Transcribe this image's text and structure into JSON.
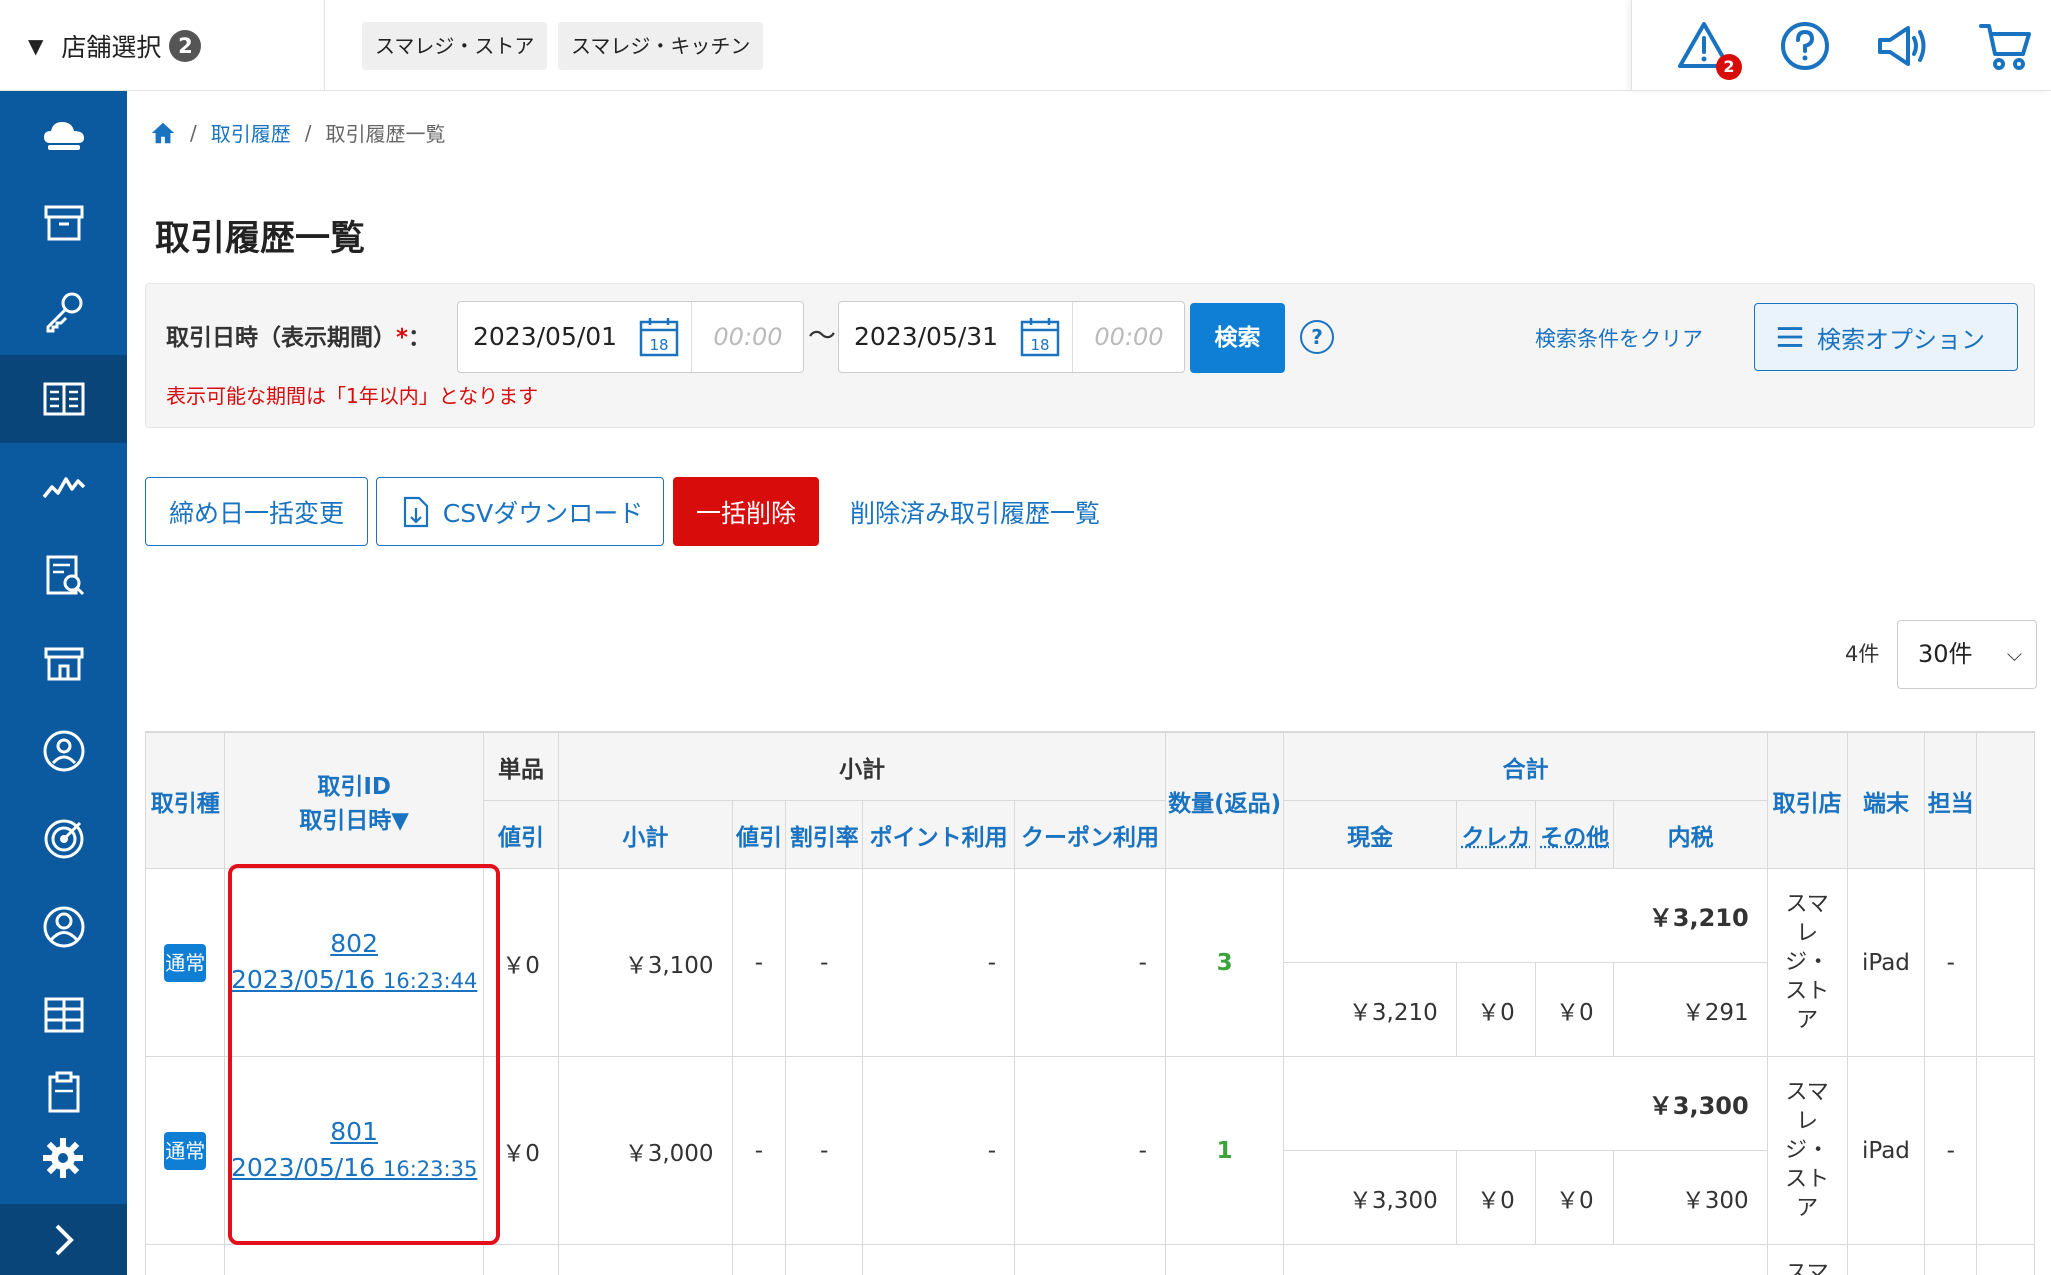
{
  "topbar": {
    "store_select_label": "店舗選択",
    "store_select_count": "2",
    "store_tags": [
      "スマレジ・ストア",
      "スマレジ・キッチン"
    ],
    "alert_count": "2",
    "icons": [
      "alert-icon",
      "help-icon",
      "announcement-icon",
      "cart-icon"
    ]
  },
  "sidebar": {
    "icons": [
      "cloud-icon",
      "archive-icon",
      "key-icon",
      "book-icon",
      "chart-icon",
      "report-icon",
      "store-icon",
      "customer-icon",
      "target-icon",
      "user-icon",
      "grid-icon",
      "clipboard-icon"
    ],
    "settings_icon": "gear-icon",
    "expand_icon": "chevron-right-icon"
  },
  "breadcrumb": {
    "home_icon": "home-icon",
    "level1": "取引履歴",
    "level2": "取引履歴一覧"
  },
  "page": {
    "title": "取引履歴一覧"
  },
  "search": {
    "label": "取引日時（表示期間）",
    "required_mark": "*",
    "colon": "：",
    "from_date": "2023/05/01",
    "from_time": "00:00",
    "to_date": "2023/05/31",
    "to_time": "00:00",
    "tilde": "〜",
    "calendar_day": "18",
    "search_button": "検索",
    "help": "?",
    "clear_link": "検索条件をクリア",
    "options_button": "検索オプション",
    "note": "表示可能な期間は「1年以内」となります"
  },
  "actions": {
    "bulk_close_date": "締め日一括変更",
    "csv_download": "CSVダウンロード",
    "bulk_delete": "一括削除",
    "deleted_history": "削除済み取引履歴一覧"
  },
  "pagination": {
    "count": "4件",
    "per_page": "30件"
  },
  "table": {
    "headers": {
      "kind": "取引種",
      "id": "取引ID",
      "datetime": "取引日時▼",
      "item": "単品",
      "item_discount": "値引",
      "subtotal_group": "小計",
      "subtotal": "小計",
      "discount": "値引",
      "discount_rate": "割引率",
      "point": "ポイント利用",
      "coupon": "クーポン利用",
      "qty": "数量(返品)",
      "total_group": "合計",
      "cash": "現金",
      "credit": "クレカ",
      "other": "その他",
      "tax": "内税",
      "store": "取引店",
      "terminal": "端末",
      "staff": "担当"
    },
    "rows": [
      {
        "kind": "通常",
        "id": "802",
        "date": "2023/05/16",
        "time": "16:23:44",
        "item_discount": "￥0",
        "subtotal": "￥3,100",
        "discount": "-",
        "discount_rate": "-",
        "point": "-",
        "coupon": "-",
        "qty": "3",
        "total": "￥3,210",
        "cash": "￥3,210",
        "credit": "￥0",
        "other": "￥0",
        "tax": "￥291",
        "store": "スマレジ・ストア",
        "terminal": "iPad",
        "staff": "-"
      },
      {
        "kind": "通常",
        "id": "801",
        "date": "2023/05/16",
        "time": "16:23:35",
        "item_discount": "￥0",
        "subtotal": "￥3,000",
        "discount": "-",
        "discount_rate": "-",
        "point": "-",
        "coupon": "-",
        "qty": "1",
        "total": "￥3,300",
        "cash": "￥3,300",
        "credit": "￥0",
        "other": "￥0",
        "tax": "￥300",
        "store": "スマレジ・ストア",
        "terminal": "iPad",
        "staff": "-"
      }
    ],
    "row3_store_fragment": "スマ"
  },
  "colors": {
    "primary": "#0f7fd6",
    "sidebar": "#0b5aa0",
    "danger": "#d90c0c",
    "highlight": "#e3101c"
  }
}
